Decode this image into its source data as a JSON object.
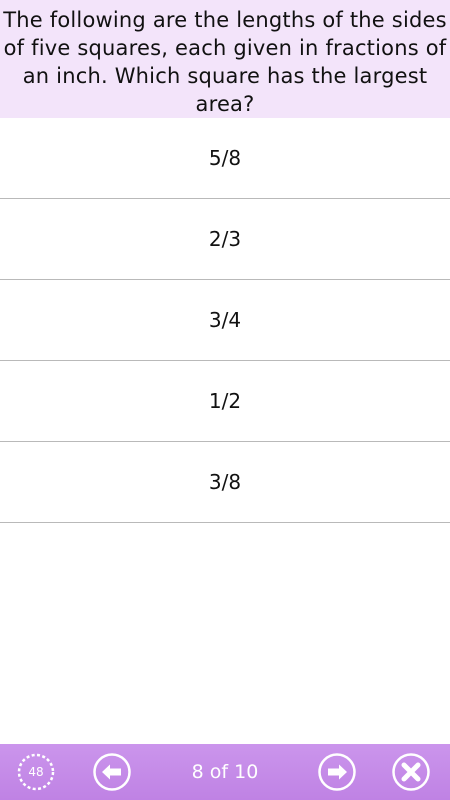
{
  "question": {
    "text": "The following are the lengths of the sides of five squares, each given in fractions of an inch. Which square has the largest area?"
  },
  "answers": [
    {
      "label": "5/8"
    },
    {
      "label": "2/3"
    },
    {
      "label": "3/4"
    },
    {
      "label": "1/2"
    },
    {
      "label": "3/8"
    }
  ],
  "toolbar": {
    "timer_value": "48",
    "page_counter": "8 of 10",
    "icons": {
      "timer": "stopwatch-icon",
      "prev": "arrow-left-icon",
      "next": "arrow-right-icon",
      "close": "close-icon"
    }
  },
  "colors": {
    "question_bg": "#f3e4fa",
    "toolbar_bg": "#c58be8",
    "divider": "#b9b9b9",
    "icon": "#ffffff"
  }
}
